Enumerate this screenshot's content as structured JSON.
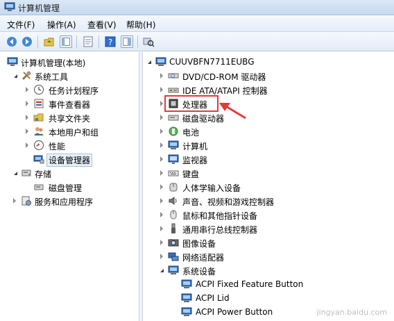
{
  "window": {
    "title": "计算机管理"
  },
  "menu": {
    "file": "文件(F)",
    "action": "操作(A)",
    "view": "查看(V)",
    "help": "帮助(H)"
  },
  "left_tree": {
    "root": "计算机管理(本地)",
    "system_tools": "系统工具",
    "task_scheduler": "任务计划程序",
    "event_viewer": "事件查看器",
    "shared_folders": "共享文件夹",
    "local_users": "本地用户和组",
    "performance": "性能",
    "device_manager": "设备管理器",
    "storage": "存储",
    "disk_management": "磁盘管理",
    "services_apps": "服务和应用程序"
  },
  "right_tree": {
    "computer_name": "CUUVBFN7711EUBG",
    "dvd": "DVD/CD-ROM 驱动器",
    "ide": "IDE ATA/ATAPI 控制器",
    "processor": "处理器",
    "disk_drives": "磁盘驱动器",
    "battery": "电池",
    "computer": "计算机",
    "monitor": "监视器",
    "keyboard": "键盘",
    "hid": "人体学输入设备",
    "sound": "声音、视频和游戏控制器",
    "mouse": "鼠标和其他指针设备",
    "usb": "通用串行总线控制器",
    "imaging": "图像设备",
    "network": "网络适配器",
    "system_devices": "系统设备",
    "acpi_fixed": "ACPI Fixed Feature Button",
    "acpi_lid": "ACPI Lid",
    "acpi_power": "ACPI Power Button"
  },
  "annotation": {
    "color": "#e53935"
  },
  "watermark": "jingyan.baidu.com"
}
